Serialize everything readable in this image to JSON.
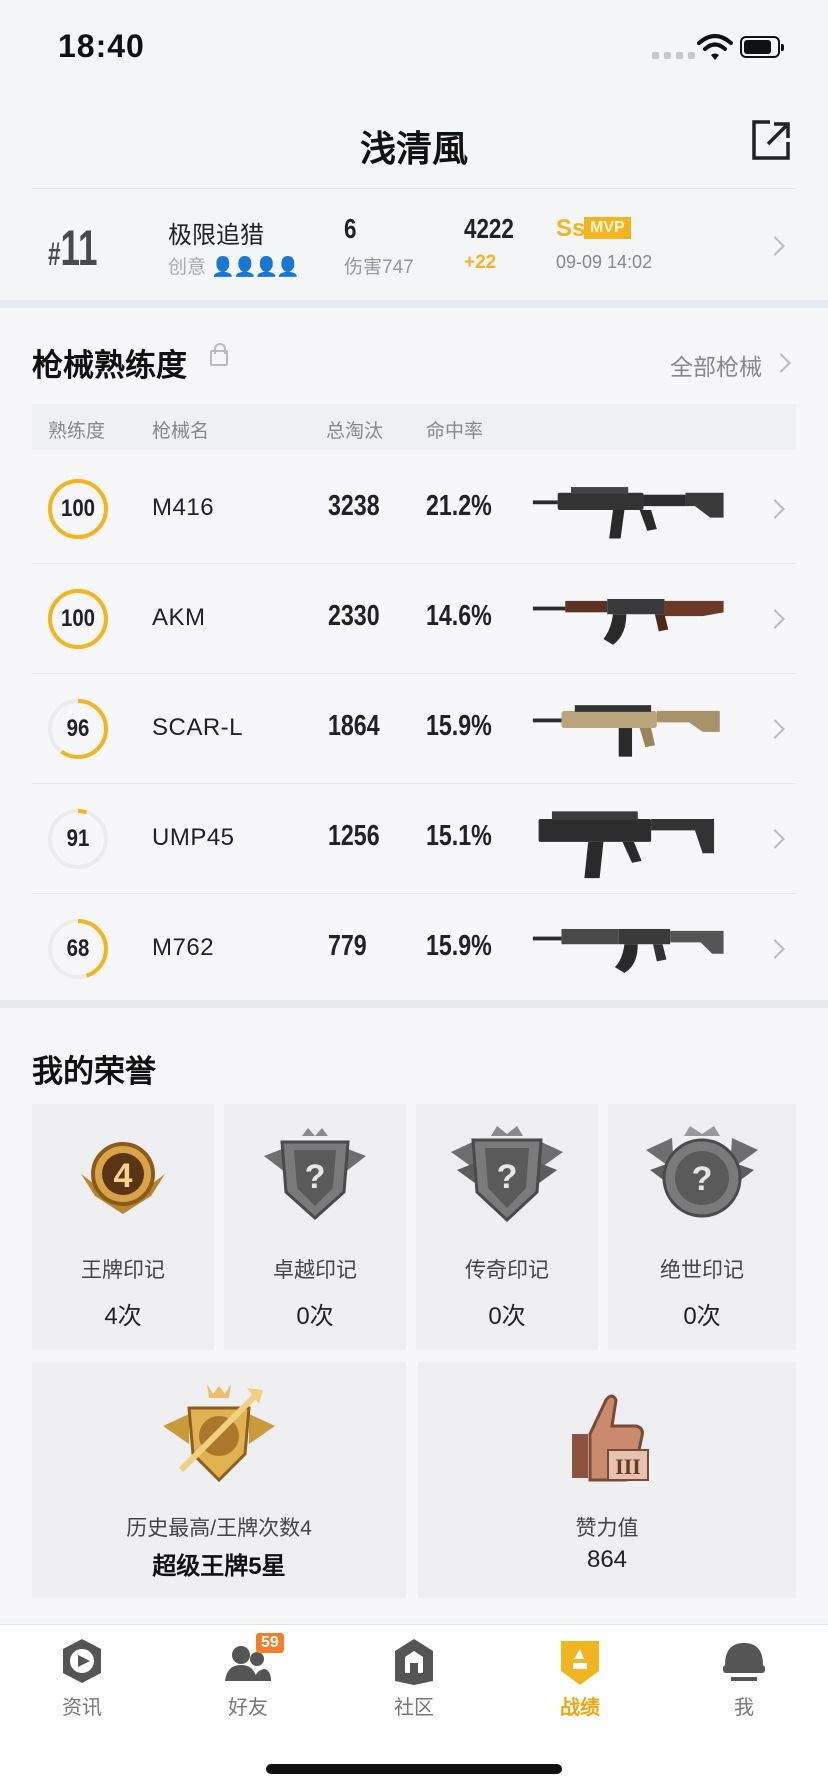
{
  "status_bar": {
    "time": "18:40"
  },
  "header": {
    "title": "浅清風"
  },
  "recent_match": {
    "rank_prefix": "#",
    "rank": "11",
    "mode": "极限追猎",
    "sub_mode": "创意",
    "kills": "6",
    "damage": "伤害747",
    "score": "4222",
    "score_delta": "+22",
    "grade": "Ss",
    "mvp": "MVP",
    "time": "09-09 14:02"
  },
  "weapons_section": {
    "title": "枪械熟练度",
    "all_link": "全部枪械",
    "columns": [
      "熟练度",
      "枪械名",
      "总淘汰",
      "命中率"
    ],
    "rows": [
      {
        "level": "100",
        "level_pct": 1.0,
        "name": "M416",
        "kills": "3238",
        "accuracy": "21.2%",
        "gun": "m416"
      },
      {
        "level": "100",
        "level_pct": 1.0,
        "name": "AKM",
        "kills": "2330",
        "accuracy": "14.6%",
        "gun": "akm"
      },
      {
        "level": "96",
        "level_pct": 0.6,
        "name": "SCAR-L",
        "kills": "1864",
        "accuracy": "15.9%",
        "gun": "scar"
      },
      {
        "level": "91",
        "level_pct": 0.05,
        "name": "UMP45",
        "kills": "1256",
        "accuracy": "15.1%",
        "gun": "ump"
      },
      {
        "level": "68",
        "level_pct": 0.45,
        "name": "M762",
        "kills": "779",
        "accuracy": "15.9%",
        "gun": "m762"
      }
    ]
  },
  "honors_section": {
    "title": "我的荣誉",
    "marks": [
      {
        "label": "王牌印记",
        "count": "4次",
        "badge_text": "4",
        "unlocked": true
      },
      {
        "label": "卓越印记",
        "count": "0次",
        "badge_text": "?",
        "unlocked": false
      },
      {
        "label": "传奇印记",
        "count": "0次",
        "badge_text": "?",
        "unlocked": false
      },
      {
        "label": "绝世印记",
        "count": "0次",
        "badge_text": "?",
        "unlocked": false
      }
    ],
    "highest": {
      "label": "历史最高/王牌次数4",
      "value": "超级王牌5星"
    },
    "likes": {
      "label": "赞力值",
      "value": "864",
      "badge_text": "III"
    }
  },
  "tabbar": {
    "items": [
      {
        "label": "资讯",
        "icon": "news-icon"
      },
      {
        "label": "好友",
        "icon": "friends-icon",
        "badge": "59"
      },
      {
        "label": "社区",
        "icon": "community-icon"
      },
      {
        "label": "战绩",
        "icon": "stats-icon",
        "active": true
      },
      {
        "label": "我",
        "icon": "profile-icon"
      }
    ]
  },
  "colors": {
    "accent": "#f0b520",
    "muted": "#888888",
    "badge": "#f27f2b"
  }
}
